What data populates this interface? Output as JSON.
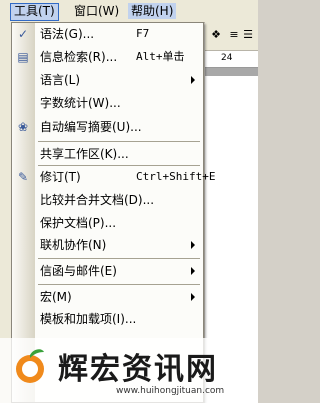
{
  "menubar": {
    "items": [
      {
        "label": "工具(T)"
      },
      {
        "label": "窗口(W)"
      },
      {
        "label": "帮助(H)"
      }
    ]
  },
  "ruler": {
    "tick": "24"
  },
  "menu": {
    "items": [
      {
        "label": "语法(G)...",
        "shortcut": "F7",
        "icon": "grammar-icon"
      },
      {
        "label": "信息检索(R)...",
        "shortcut": "Alt+单击",
        "icon": "research-icon"
      },
      {
        "label": "语言(L)",
        "shortcut": "",
        "icon": ""
      },
      {
        "label": "字数统计(W)...",
        "shortcut": "",
        "icon": ""
      },
      {
        "label": "自动编写摘要(U)...",
        "shortcut": "",
        "icon": "autosummarize-icon"
      },
      {
        "label": "共享工作区(K)...",
        "shortcut": "",
        "icon": ""
      },
      {
        "label": "修订(T)",
        "shortcut": "Ctrl+Shift+E",
        "icon": "track-changes-icon"
      },
      {
        "label": "比较并合并文档(D)...",
        "shortcut": "",
        "icon": ""
      },
      {
        "label": "保护文档(P)...",
        "shortcut": "",
        "icon": ""
      },
      {
        "label": "联机协作(N)",
        "shortcut": "",
        "icon": ""
      },
      {
        "label": "信函与邮件(E)",
        "shortcut": "",
        "icon": ""
      },
      {
        "label": "宏(M)",
        "shortcut": "",
        "icon": ""
      },
      {
        "label": "模板和加载项(I)...",
        "shortcut": "",
        "icon": ""
      }
    ]
  },
  "watermark": {
    "brand": "辉宏资讯网",
    "url": "www.huihongjituan.com"
  }
}
